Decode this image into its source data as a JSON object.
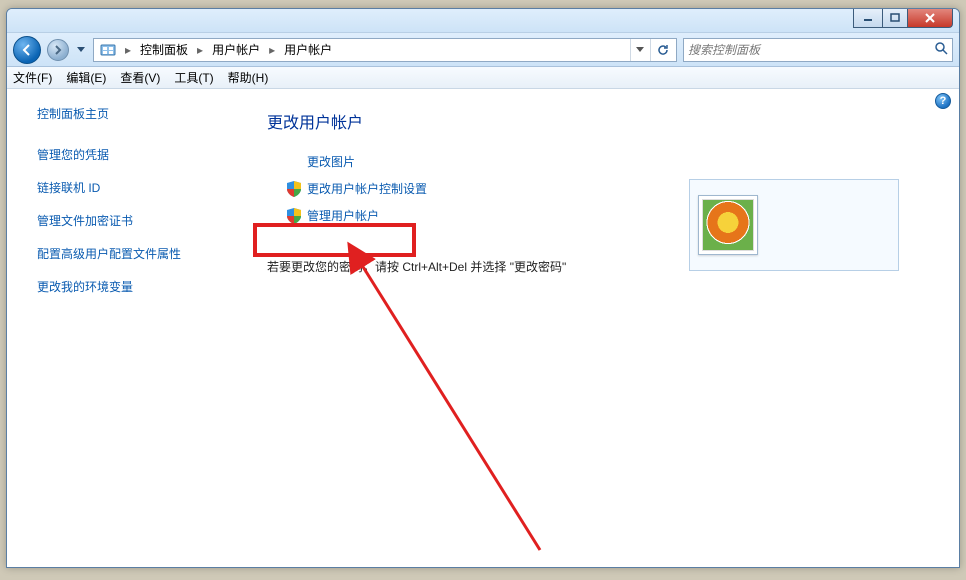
{
  "breadcrumb": {
    "items": [
      "控制面板",
      "用户帐户",
      "用户帐户"
    ]
  },
  "search": {
    "placeholder": "搜索控制面板"
  },
  "menu": {
    "file": "文件(F)",
    "edit": "编辑(E)",
    "view": "查看(V)",
    "tools": "工具(T)",
    "help": "帮助(H)"
  },
  "sidebar": {
    "home": "控制面板主页",
    "links": [
      "管理您的凭据",
      "链接联机 ID",
      "管理文件加密证书",
      "配置高级用户配置文件属性",
      "更改我的环境变量"
    ]
  },
  "main": {
    "heading": "更改用户帐户",
    "tasks": {
      "change_picture": "更改图片",
      "change_uac": "更改用户帐户控制设置",
      "manage_accounts": "管理用户帐户"
    },
    "note": "若要更改您的密码，请按 Ctrl+Alt+Del 并选择 \"更改密码\""
  }
}
